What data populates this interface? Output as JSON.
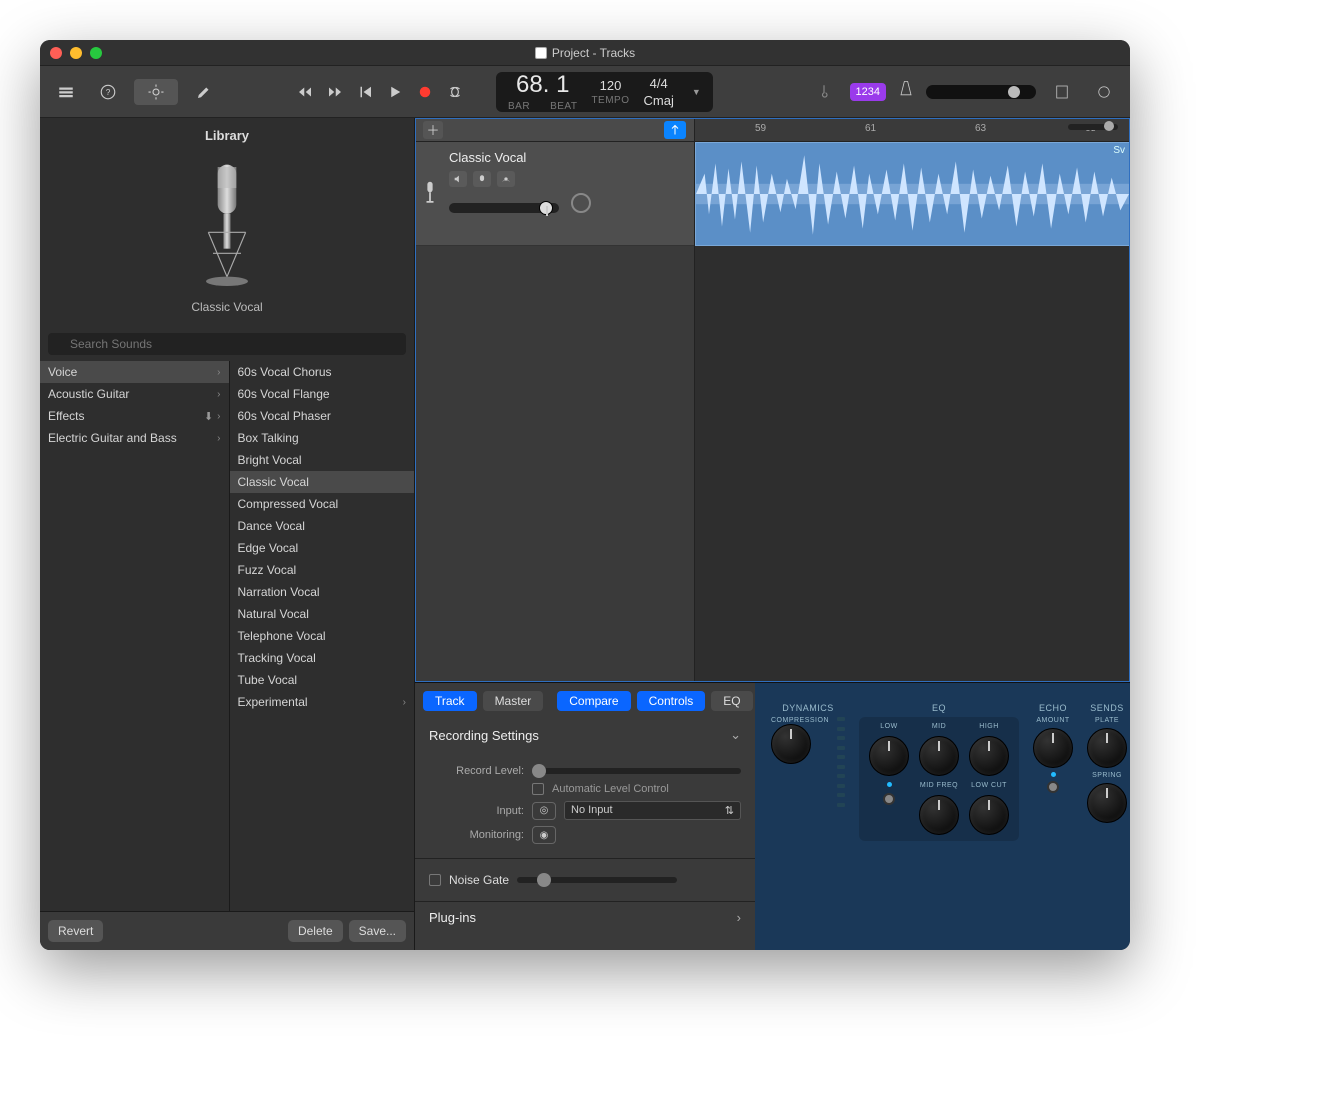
{
  "window_title": "Project - Tracks",
  "lcd": {
    "bar": "68. 1",
    "bar_label": "BAR",
    "beat_label": "BEAT",
    "tempo": "120",
    "tempo_label": "TEMPO",
    "sig": "4/4",
    "key": "Cmaj"
  },
  "countin_chip": "1234",
  "library": {
    "title": "Library",
    "preset_name": "Classic Vocal",
    "search_placeholder": "Search Sounds",
    "categories": [
      {
        "label": "Voice",
        "selected": true,
        "download": false
      },
      {
        "label": "Acoustic Guitar",
        "selected": false,
        "download": false
      },
      {
        "label": "Effects",
        "selected": false,
        "download": true
      },
      {
        "label": "Electric Guitar and Bass",
        "selected": false,
        "download": false
      }
    ],
    "presets": [
      "60s Vocal Chorus",
      "60s Vocal Flange",
      "60s Vocal Phaser",
      "Box Talking",
      "Bright Vocal",
      "Classic Vocal",
      "Compressed Vocal",
      "Dance Vocal",
      "Edge Vocal",
      "Fuzz Vocal",
      "Narration Vocal",
      "Natural Vocal",
      "Telephone Vocal",
      "Tracking Vocal",
      "Tube Vocal",
      "Experimental"
    ],
    "selected_preset": "Classic Vocal",
    "buttons": {
      "revert": "Revert",
      "delete": "Delete",
      "save": "Save..."
    }
  },
  "ruler_marks": {
    "59": "59",
    "61": "61",
    "63": "63",
    "65": "65"
  },
  "track": {
    "name": "Classic Vocal",
    "region_label": "Sv"
  },
  "inspector": {
    "tabs": {
      "track": "Track",
      "master": "Master",
      "compare": "Compare",
      "controls": "Controls",
      "eq": "EQ"
    },
    "section1": "Recording Settings",
    "record_level": "Record Level:",
    "auto_level": "Automatic Level Control",
    "input_label": "Input:",
    "input_value": "No Input",
    "monitoring_label": "Monitoring:",
    "noise_gate": "Noise Gate",
    "plugins": "Plug-ins"
  },
  "smart": {
    "dynamics": "DYNAMICS",
    "compression": "COMPRESSION",
    "eq": "EQ",
    "low": "LOW",
    "mid": "MID",
    "high": "HIGH",
    "midfreq": "MID FREQ",
    "lowcut": "LOW CUT",
    "echo": "ECHO",
    "amount": "AMOUNT",
    "sends": "SENDS",
    "plate": "PLATE",
    "spring": "SPRING"
  }
}
